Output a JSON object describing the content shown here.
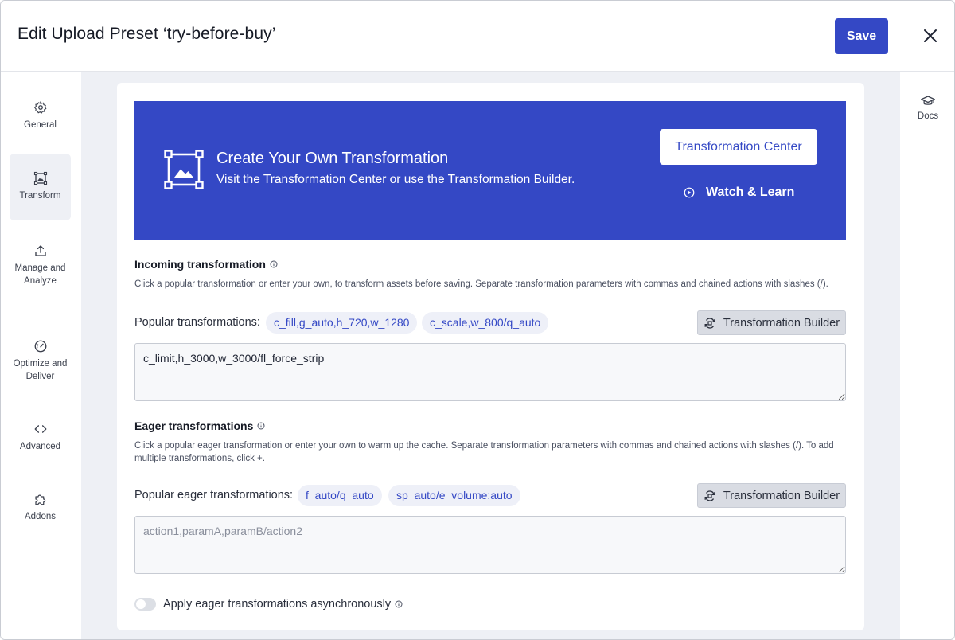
{
  "header": {
    "title": "Edit Upload Preset ‘try-before-buy’",
    "save_label": "Save"
  },
  "sidebar": {
    "items": [
      {
        "label": "General",
        "icon": "gear-icon"
      },
      {
        "label": "Transform",
        "icon": "transform-icon",
        "active": true
      },
      {
        "label": "Manage and Analyze",
        "icon": "upload-icon"
      },
      {
        "label": "Optimize and Deliver",
        "icon": "gauge-icon"
      },
      {
        "label": "Advanced",
        "icon": "code-icon"
      },
      {
        "label": "Addons",
        "icon": "puzzle-icon"
      }
    ]
  },
  "rail": {
    "docs_label": "Docs"
  },
  "banner": {
    "title": "Create Your Own Transformation",
    "subtitle": "Visit the Transformation Center or use the Transformation Builder.",
    "center_button": "Transformation Center",
    "watch_label": "Watch & Learn"
  },
  "incoming": {
    "title": "Incoming transformation",
    "description": "Click a popular transformation or enter your own, to transform assets before saving. Separate transformation parameters with commas and chained actions with slashes (/).",
    "popular_label": "Popular transformations:",
    "chips": [
      "c_fill,g_auto,h_720,w_1280",
      "c_scale,w_800/q_auto"
    ],
    "builder_label": "Transformation Builder",
    "value": "c_limit,h_3000,w_3000/fl_force_strip"
  },
  "eager": {
    "title": "Eager transformations",
    "description": "Click a popular eager transformation or enter your own to warm up the cache. Separate transformation parameters with commas and chained actions with slashes (/). To add multiple transformations, click +.",
    "popular_label": "Popular eager transformations:",
    "chips": [
      "f_auto/q_auto",
      "sp_auto/e_volume:auto"
    ],
    "builder_label": "Transformation Builder",
    "placeholder": "action1,paramA,paramB/action2",
    "async_label": "Apply eager transformations asynchronously",
    "async_enabled": false
  },
  "colors": {
    "accent": "#3448c5",
    "canvas": "#eef0f5"
  }
}
